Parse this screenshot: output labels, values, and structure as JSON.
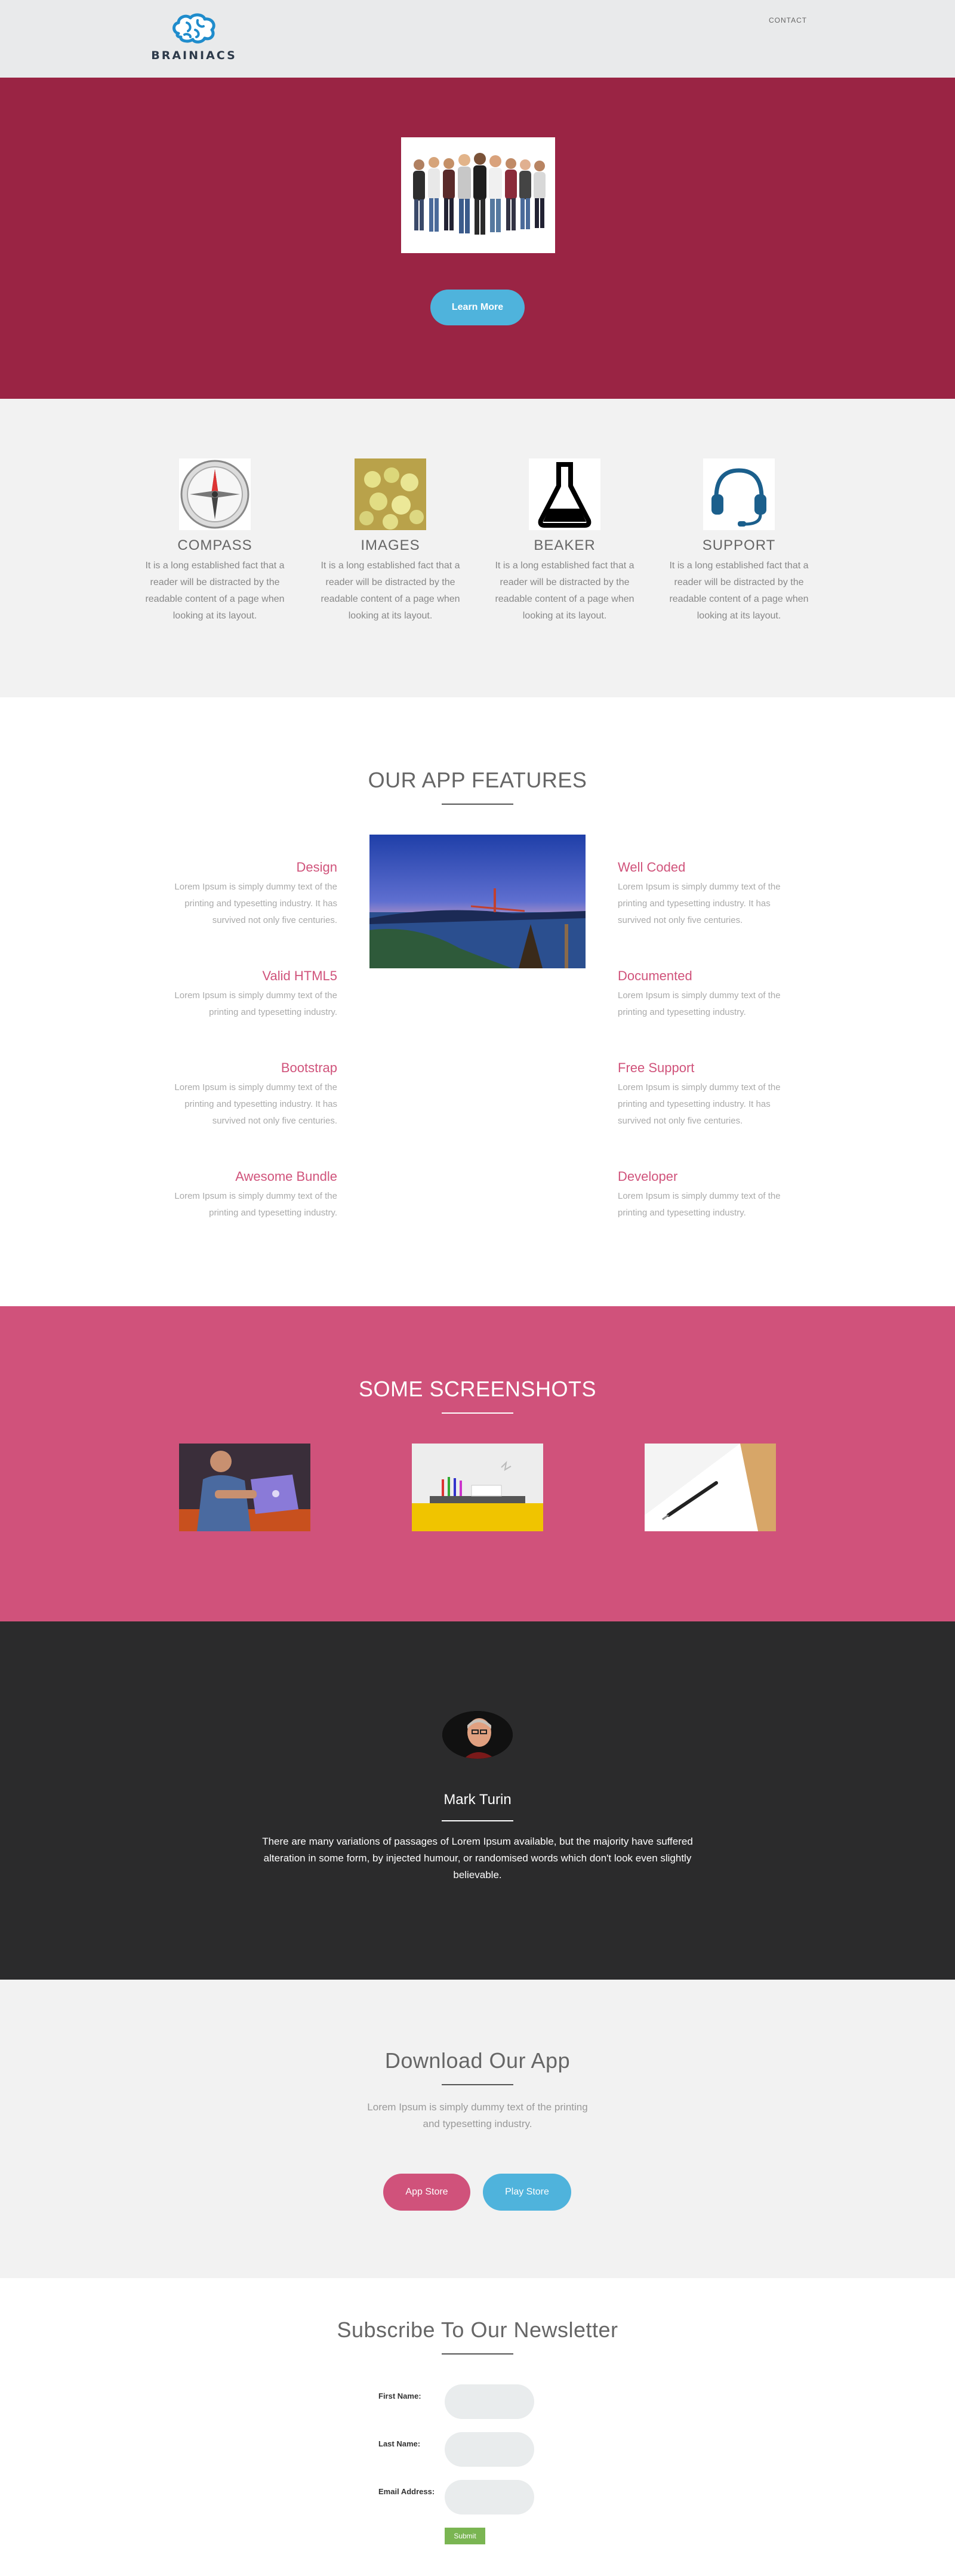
{
  "header": {
    "brand": "BRAINIACS",
    "nav_contact": "CONTACT"
  },
  "hero": {
    "button_label": "Learn More"
  },
  "icons": [
    {
      "title": "COMPASS",
      "icon": "compass-icon",
      "desc": "It is a long established fact that a reader will be distracted by the readable content of a page when looking at its layout."
    },
    {
      "title": "IMAGES",
      "icon": "images-icon",
      "desc": "It is a long established fact that a reader will be distracted by the readable content of a page when looking at its layout."
    },
    {
      "title": "BEAKER",
      "icon": "beaker-icon",
      "desc": "It is a long established fact that a reader will be distracted by the readable content of a page when looking at its layout."
    },
    {
      "title": "SUPPORT",
      "icon": "headset-icon",
      "desc": "It is a long established fact that a reader will be distracted by the readable content of a page when looking at its layout."
    }
  ],
  "features": {
    "title": "OUR APP FEATURES",
    "left": [
      {
        "name": "Design",
        "desc": "Lorem Ipsum is simply dummy text of the printing and typesetting industry. It has survived not only five centuries."
      },
      {
        "name": "Valid HTML5",
        "desc": "Lorem Ipsum is simply dummy text of the printing and typesetting industry."
      },
      {
        "name": "Bootstrap",
        "desc": "Lorem Ipsum is simply dummy text of the printing and typesetting industry. It has survived not only five centuries."
      },
      {
        "name": "Awesome Bundle",
        "desc": "Lorem Ipsum is simply dummy text of the printing and typesetting industry."
      }
    ],
    "right": [
      {
        "name": "Well Coded",
        "desc": "Lorem Ipsum is simply dummy text of the printing and typesetting industry. It has survived not only five centuries."
      },
      {
        "name": "Documented",
        "desc": "Lorem Ipsum is simply dummy text of the printing and typesetting industry."
      },
      {
        "name": "Free Support",
        "desc": "Lorem Ipsum is simply dummy text of the printing and typesetting industry. It has survived not only five centuries."
      },
      {
        "name": "Developer",
        "desc": "Lorem Ipsum is simply dummy text of the printing and typesetting industry."
      }
    ]
  },
  "screenshots": {
    "title": "SOME SCREENSHOTS"
  },
  "testimonial": {
    "name": "Mark Turin",
    "quote": "There are many variations of passages of Lorem Ipsum available, but the majority have suffered alteration in some form, by injected humour, or randomised words which don't look even slightly believable."
  },
  "download": {
    "title": "Download Our App",
    "desc": "Lorem Ipsum is simply dummy text of the printing and typesetting industry.",
    "app_store": "App Store",
    "play_store": "Play Store"
  },
  "newsletter": {
    "title": "Subscribe To Our Newsletter",
    "first_name_label": "First Name:",
    "last_name_label": "Last Name:",
    "email_label": "Email Address:",
    "submit_label": "Submit"
  },
  "colors": {
    "hero_bg": "#9a2444",
    "accent_pink": "#d0537b",
    "accent_blue": "#4fb3dc",
    "dark_bg": "#2b2b2c",
    "submit_green": "#7ab552"
  }
}
